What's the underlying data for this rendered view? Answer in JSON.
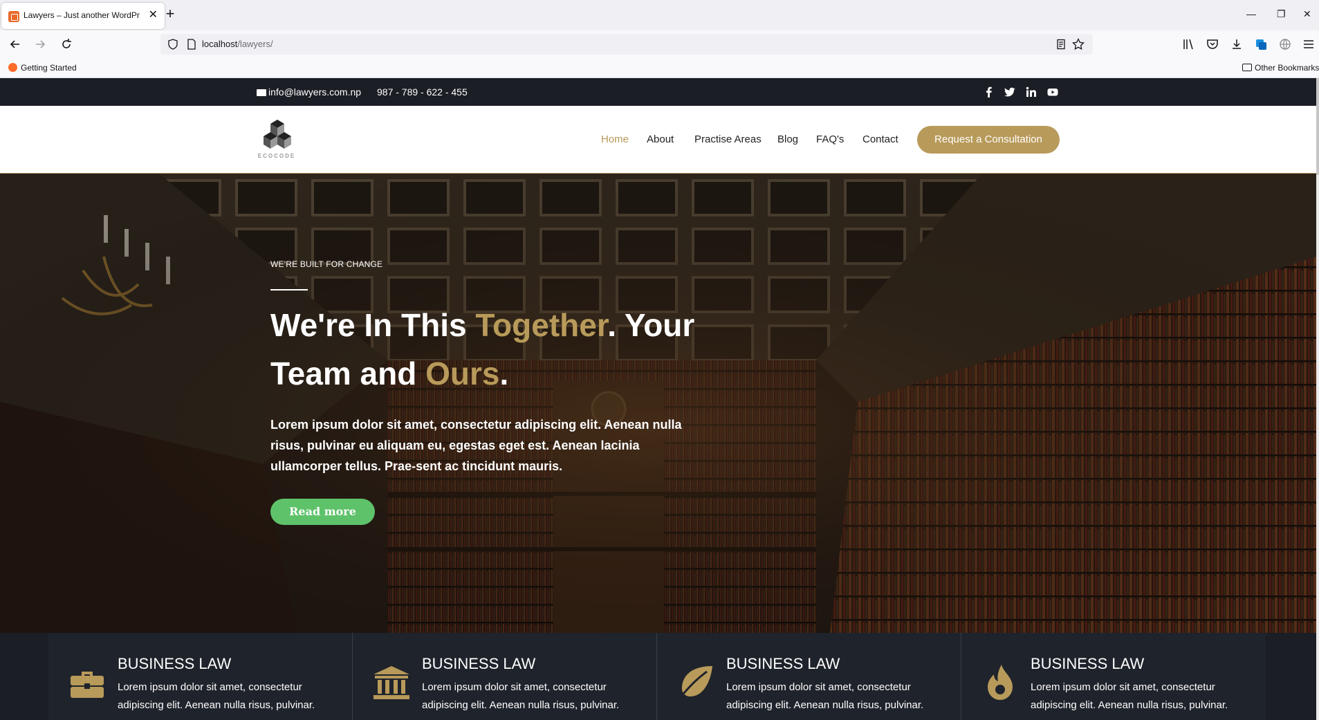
{
  "browser": {
    "tab_title": "Lawyers – Just another WordPr",
    "url_host": "localhost",
    "url_path": "/lawyers/",
    "bookmarks": {
      "getting_started": "Getting Started",
      "other": "Other Bookmarks"
    }
  },
  "topbar": {
    "email": "info@lawyers.com.np",
    "phone": "987 - 789 - 622 - 455",
    "social_icons": [
      "facebook-icon",
      "twitter-icon",
      "linkedin-icon",
      "youtube-icon"
    ]
  },
  "header": {
    "logo_text": "ECOCODE",
    "nav": [
      "Home",
      "About",
      "Practise Areas",
      "Blog",
      "FAQ's",
      "Contact"
    ],
    "active_nav": "Home",
    "cta": "Request a Consultation"
  },
  "hero": {
    "eyebrow": "WE'RE BUILT FOR CHANGE",
    "headline": {
      "part1": "We're In This ",
      "gold1": "Together",
      "part2": ". Your Team and ",
      "gold2": "Ours",
      "part3": "."
    },
    "lead": "Lorem ipsum dolor sit amet, consectetur adipiscing elit. Aenean nulla risus, pulvinar eu aliquam eu, egestas eget est. Aenean lacinia ullamcorper tellus. Prae-sent ac tincidunt mauris.",
    "button": "Read more"
  },
  "services": [
    {
      "icon": "briefcase-icon",
      "title": "BUSINESS LAW",
      "text": "Lorem ipsum dolor sit amet, consectetur adipiscing elit. Aenean nulla risus, pulvinar."
    },
    {
      "icon": "courthouse-icon",
      "title": "BUSINESS LAW",
      "text": "Lorem ipsum dolor sit amet, consectetur adipiscing elit. Aenean nulla risus, pulvinar."
    },
    {
      "icon": "leaf-icon",
      "title": "BUSINESS LAW",
      "text": "Lorem ipsum dolor sit amet, consectetur adipiscing elit. Aenean nulla risus, pulvinar."
    },
    {
      "icon": "flame-icon",
      "title": "BUSINESS LAW",
      "text": "Lorem ipsum dolor sit amet, consectetur adipiscing elit. Aenean nulla risus, pulvinar."
    }
  ],
  "colors": {
    "gold": "#b89a5a",
    "dark": "#1b1e25",
    "green": "#5ec26a"
  }
}
